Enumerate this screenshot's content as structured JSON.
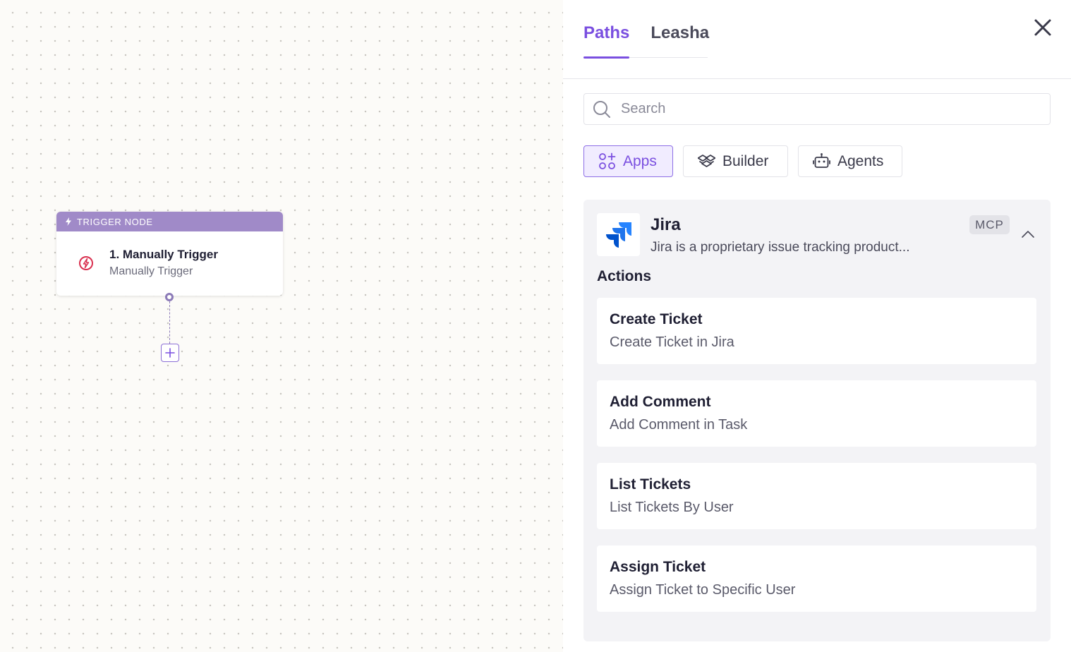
{
  "canvas": {
    "trigger_node": {
      "header": "TRIGGER NODE",
      "title": "1. Manually Trigger",
      "subtitle": "Manually Trigger"
    }
  },
  "panel": {
    "tabs": [
      {
        "label": "Paths",
        "active": true
      },
      {
        "label": "Leasha",
        "active": false
      }
    ],
    "search": {
      "placeholder": "Search",
      "value": ""
    },
    "filters": [
      {
        "label": "Apps",
        "icon": "apps-icon",
        "active": true
      },
      {
        "label": "Builder",
        "icon": "builder-icon",
        "active": false
      },
      {
        "label": "Agents",
        "icon": "robot-icon",
        "active": false
      }
    ],
    "app": {
      "name": "Jira",
      "description": "Jira is a proprietary issue tracking product...",
      "badge": "MCP",
      "actions_heading": "Actions",
      "actions": [
        {
          "title": "Create Ticket",
          "description": "Create Ticket in Jira"
        },
        {
          "title": "Add Comment",
          "description": "Add Comment in Task"
        },
        {
          "title": "List Tickets",
          "description": "List Tickets By User"
        },
        {
          "title": "Assign Ticket",
          "description": "Assign Ticket to Specific User"
        }
      ]
    }
  },
  "colors": {
    "accent": "#7a4fe0",
    "trigger_header": "#a08ac8",
    "trigger_icon": "#d9304f",
    "jira_blue": "#2684ff"
  }
}
